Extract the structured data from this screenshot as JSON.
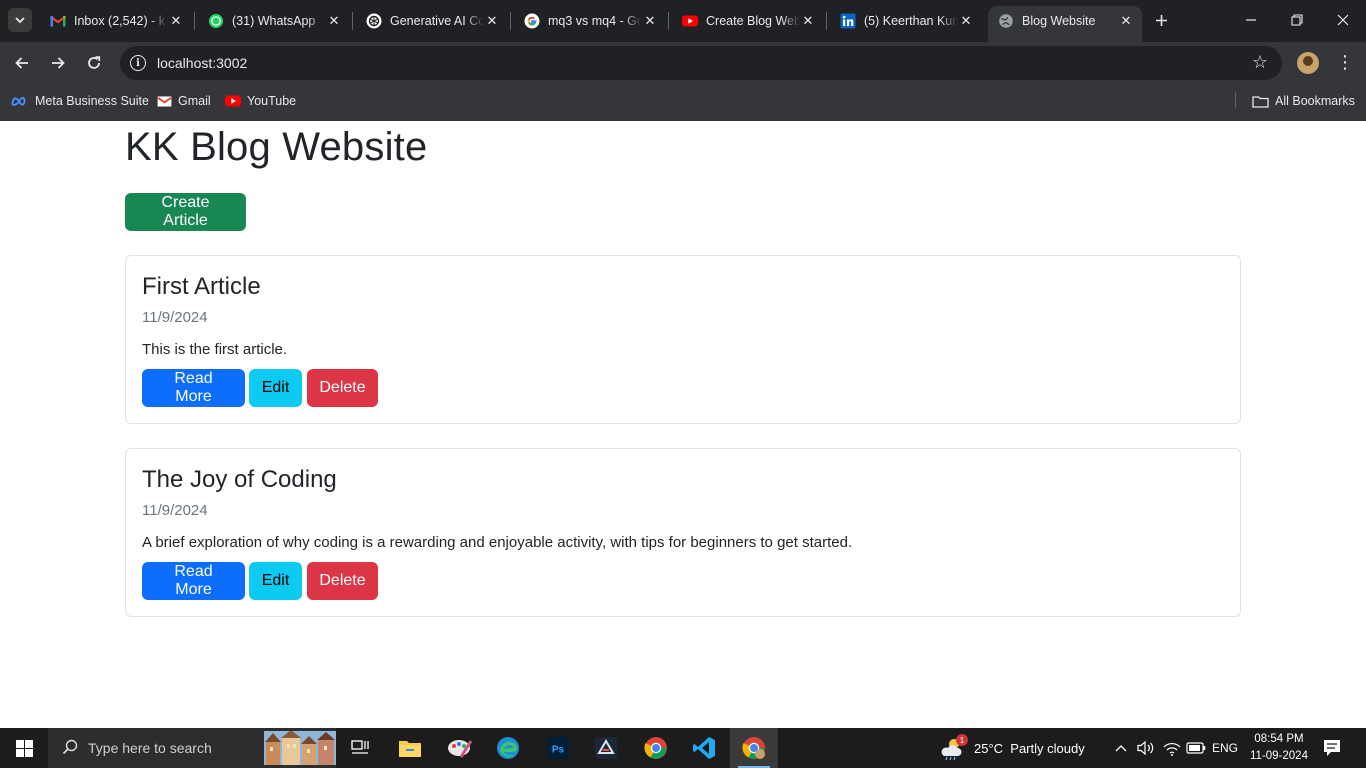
{
  "browser": {
    "tabs": [
      {
        "title": "Inbox (2,542) - k",
        "icon": "gmail-icon",
        "active": false
      },
      {
        "title": "(31) WhatsApp",
        "icon": "whatsapp-icon",
        "active": false
      },
      {
        "title": "Generative AI Co",
        "icon": "chatgpt-icon",
        "active": false
      },
      {
        "title": "mq3 vs mq4 - Go",
        "icon": "google-icon",
        "active": false
      },
      {
        "title": "Create Blog Web",
        "icon": "youtube-icon",
        "active": false
      },
      {
        "title": "(5) Keerthan Kum",
        "icon": "linkedin-icon",
        "active": false
      },
      {
        "title": "Blog Website",
        "icon": "globe-icon",
        "active": true
      }
    ],
    "url": "localhost:3002",
    "bookmarks": [
      {
        "label": "Meta Business Suite",
        "icon": "meta-icon"
      },
      {
        "label": "Gmail",
        "icon": "gmail-icon"
      },
      {
        "label": "YouTube",
        "icon": "youtube-icon"
      }
    ],
    "all_bookmarks_label": "All Bookmarks"
  },
  "page": {
    "site_title": "KK Blog Website",
    "create_button": "Create Article",
    "articles": [
      {
        "title": "First Article",
        "date": "11/9/2024",
        "summary": "This is the first article.",
        "read_more": "Read More",
        "edit": "Edit",
        "delete": "Delete"
      },
      {
        "title": "The Joy of Coding",
        "date": "11/9/2024",
        "summary": "A brief exploration of why coding is a rewarding and enjoyable activity, with tips for beginners to get started.",
        "read_more": "Read More",
        "edit": "Edit",
        "delete": "Delete"
      }
    ]
  },
  "taskbar": {
    "search_placeholder": "Type here to search",
    "weather": "25°C  Partly cloudy",
    "weather_badge": "1",
    "language": "ENG",
    "time": "08:54 PM",
    "date": "11-09-2024"
  },
  "colors": {
    "success": "#198754",
    "primary": "#0d6efd",
    "info": "#0dcaf0",
    "danger": "#dc3545"
  }
}
